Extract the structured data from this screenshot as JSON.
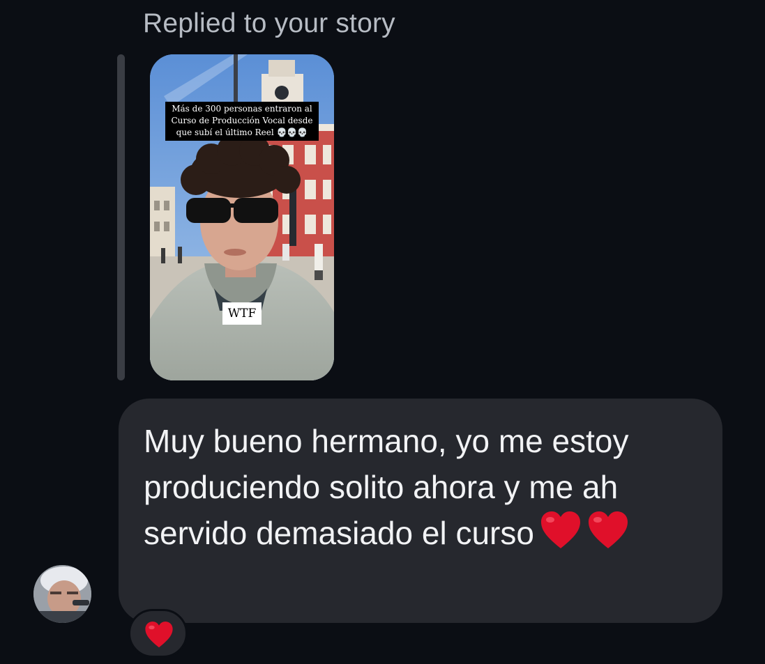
{
  "story_reply": {
    "label": "Replied to your story",
    "caption": "Más de 300 personas entraron al Curso de Producción Vocal desde que subí el último Reel 💀💀💀",
    "sticker": "WTF"
  },
  "message": {
    "text": "Muy bueno hermano, yo me estoy produciendo solito ahora y me ah servido demasiado el curso",
    "inline_emojis": [
      "heart-icon",
      "heart-icon"
    ]
  },
  "reaction": {
    "emoji": "heart-icon"
  },
  "colors": {
    "background": "#0b0e14",
    "bubble": "#26282e",
    "heart": "#e0102a",
    "label": "#b7bcc4"
  }
}
